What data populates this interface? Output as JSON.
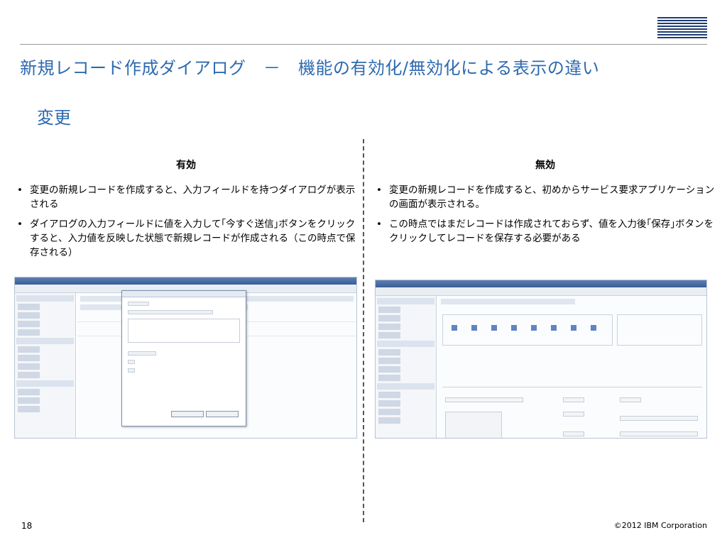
{
  "brand": {
    "logo_text": "IBM",
    "color": "#1f3d73"
  },
  "title": "新規レコード作成ダイアログ　－　機能の有効化/無効化による表示の違い",
  "subtitle": "変更",
  "left": {
    "heading": "有効",
    "bullets": [
      "変更の新規レコードを作成すると、入力フィールドを持つダイアログが表示される",
      "ダイアログの入力フィールドに値を入力して｢今すぐ送信｣ボタンをクリックすると、入力値を反映した状態で新規レコードが作成される（この時点で保存される）"
    ]
  },
  "right": {
    "heading": "無効",
    "bullets": [
      "変更の新規レコードを作成すると、初めからサービス要求アプリケーションの画面が表示される。",
      "この時点ではまだレコードは作成されておらず、値を入力後｢保存｣ボタンをクリックしてレコードを保存する必要がある"
    ]
  },
  "page_number": "18",
  "copyright": "©2012 IBM Corporation",
  "colors": {
    "title": "#2d6ab0",
    "rule": "#9a9a9a"
  }
}
